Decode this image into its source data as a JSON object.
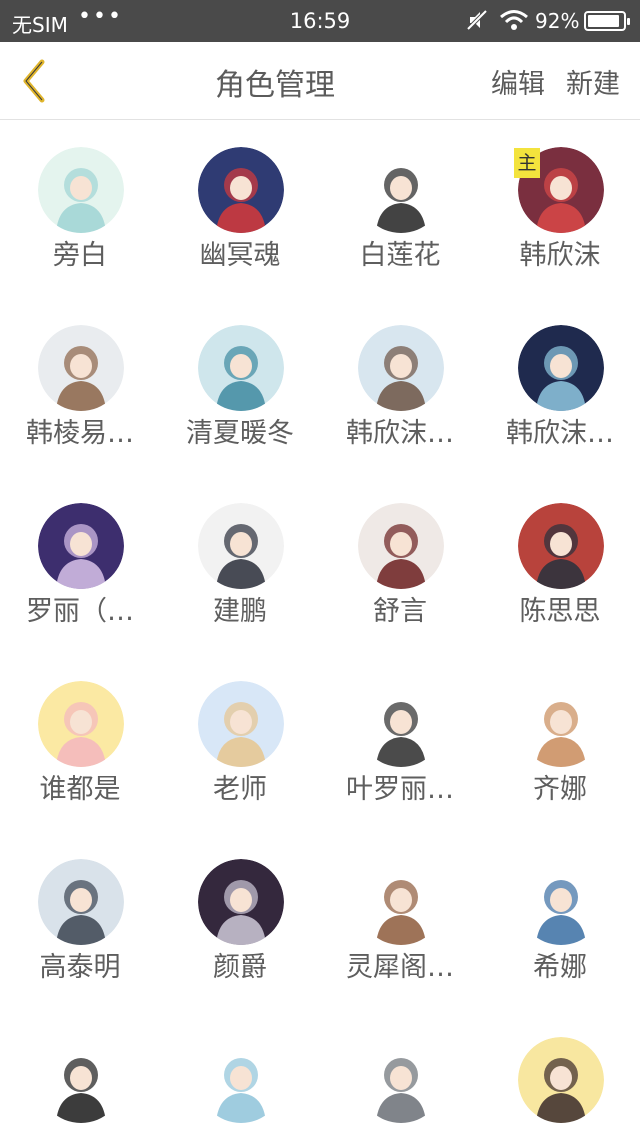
{
  "status_bar": {
    "carrier": "无SIM",
    "dots": "•••",
    "time": "16:59",
    "battery_percent": "92%",
    "battery_level": 0.92
  },
  "nav": {
    "title": "角色管理",
    "edit_label": "编辑",
    "new_label": "新建"
  },
  "main_badge": "主",
  "roles": [
    {
      "name": "旁白",
      "bg": "#e4f4ee",
      "fg": "#9fd4d4"
    },
    {
      "name": "幽冥魂",
      "bg": "#2f3b73",
      "fg": "#d63a3a"
    },
    {
      "name": "白莲花",
      "bg": "#ffffff",
      "fg": "#222222"
    },
    {
      "name": "韩欣沫",
      "bg": "#7a2f3f",
      "fg": "#d94848"
    },
    {
      "name": "韩棱易…",
      "bg": "#e9ecef",
      "fg": "#8b6447"
    },
    {
      "name": "清夏暖冬",
      "bg": "#cfe6ec",
      "fg": "#3f8aa1"
    },
    {
      "name": "韩欣沫…",
      "bg": "#d8e6ef",
      "fg": "#6d5344"
    },
    {
      "name": "韩欣沫…",
      "bg": "#1f2a4e",
      "fg": "#8fc7e0"
    },
    {
      "name": "罗丽（…",
      "bg": "#3d2e6e",
      "fg": "#d8c2ea"
    },
    {
      "name": "建鹏",
      "bg": "#f2f2f2",
      "fg": "#2a2e3a"
    },
    {
      "name": "舒言",
      "bg": "#efe9e6",
      "fg": "#6b1f1f"
    },
    {
      "name": "陈思思",
      "bg": "#b8433c",
      "fg": "#26313d"
    },
    {
      "name": "谁都是",
      "bg": "#fbe9a3",
      "fg": "#f3b6c0"
    },
    {
      "name": "老师",
      "bg": "#d8e7f7",
      "fg": "#e8c58e"
    },
    {
      "name": "叶罗丽…",
      "bg": "#ffffff",
      "fg": "#2b2b2b"
    },
    {
      "name": "齐娜",
      "bg": "#ffffff",
      "fg": "#c98b5a"
    },
    {
      "name": "高泰明",
      "bg": "#d9e2ea",
      "fg": "#3b4451"
    },
    {
      "name": "颜爵",
      "bg": "#34283d",
      "fg": "#cfc9d8"
    },
    {
      "name": "灵犀阁…",
      "bg": "#ffffff",
      "fg": "#8d5a3b"
    },
    {
      "name": "希娜",
      "bg": "#ffffff",
      "fg": "#3a6ea3"
    },
    {
      "name": "",
      "bg": "#ffffff",
      "fg": "#1a1a1a"
    },
    {
      "name": "",
      "bg": "#ffffff",
      "fg": "#8ec3d9"
    },
    {
      "name": "",
      "bg": "#ffffff",
      "fg": "#6a6f75"
    },
    {
      "name": "",
      "bg": "#f8e7a0",
      "fg": "#3a2a2a"
    }
  ],
  "icons": {
    "back": "chevron-left-icon",
    "mute": "mute-icon",
    "wifi": "wifi-icon",
    "battery": "battery-icon"
  },
  "colors": {
    "status_bar_bg": "#4a4a4a",
    "back_arrow": "#e0b52c",
    "text": "#5e5e5e"
  }
}
